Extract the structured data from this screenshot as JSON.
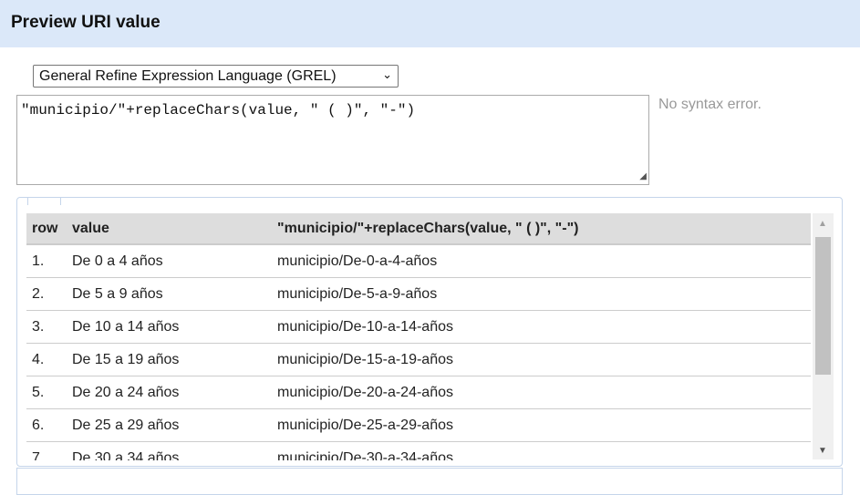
{
  "dialog": {
    "title": "Preview URI value"
  },
  "language": {
    "selected": "General Refine Expression Language (GREL)"
  },
  "expression": "\"municipio/\"+replaceChars(value, \" ( )\", \"-\")",
  "status": "No syntax error.",
  "table": {
    "headers": [
      "row",
      "value",
      "\"municipio/\"+replaceChars(value, \" ( )\", \"-\")"
    ],
    "rows": [
      [
        "1.",
        "De 0 a 4 años",
        "municipio/De-0-a-4-años"
      ],
      [
        "2.",
        "De 5 a 9 años",
        "municipio/De-5-a-9-años"
      ],
      [
        "3.",
        "De 10 a 14 años",
        "municipio/De-10-a-14-años"
      ],
      [
        "4.",
        "De 15 a 19 años",
        "municipio/De-15-a-19-años"
      ],
      [
        "5.",
        "De 20 a 24 años",
        "municipio/De-20-a-24-años"
      ],
      [
        "6.",
        "De 25 a 29 años",
        "municipio/De-25-a-29-años"
      ],
      [
        "7.",
        "De 30 a 34 años",
        "municipio/De-30-a-34-años"
      ]
    ]
  }
}
